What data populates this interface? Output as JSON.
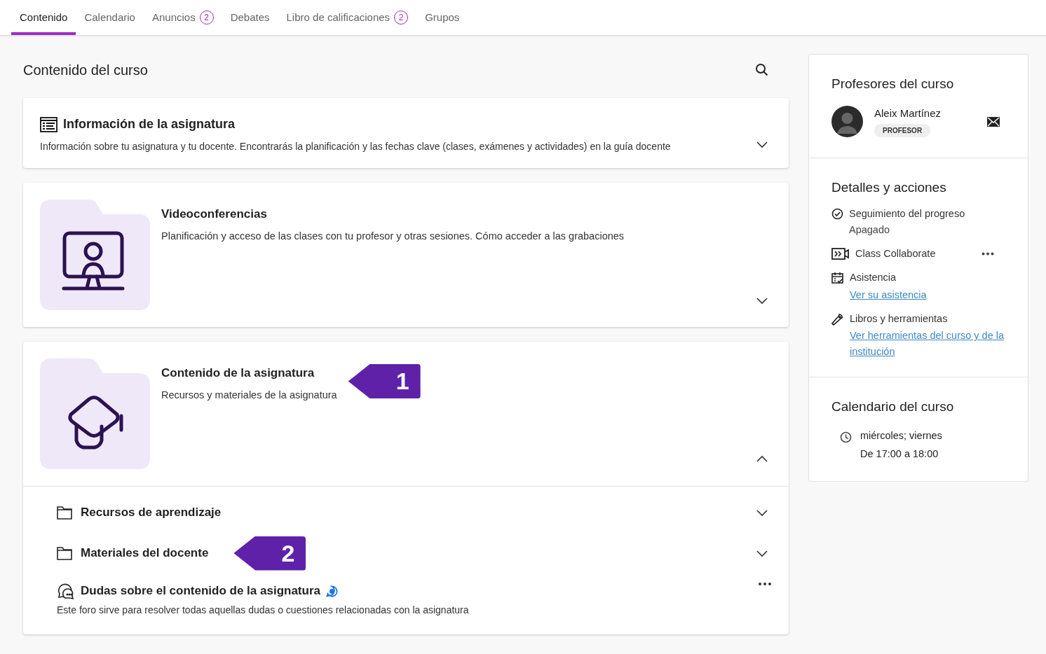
{
  "tabs": [
    {
      "label": "Contenido",
      "selected": true
    },
    {
      "label": "Calendario",
      "selected": false
    },
    {
      "label": "Anuncios",
      "badge": "2",
      "selected": false
    },
    {
      "label": "Debates",
      "selected": false
    },
    {
      "label": "Libro de calificaciones",
      "badge": "2",
      "selected": false
    },
    {
      "label": "Grupos",
      "selected": false
    }
  ],
  "main": {
    "title": "Contenido del curso",
    "items": [
      {
        "kind": "info",
        "title": "Información de la asignatura",
        "description": "Información sobre tu asignatura y tu docente. Encontrarás la planificación y las fechas clave (clases, exámenes y actividades) en la guía docente",
        "expanded": false
      },
      {
        "kind": "video",
        "title": "Videoconferencias",
        "description": "Planificación y acceso de las clases con tu profesor y otras sesiones. Cómo acceder a las grabaciones",
        "expanded": false
      },
      {
        "kind": "course",
        "title": "Contenido de la asignatura",
        "description": "Recursos y materiales de la asignatura",
        "callout": "1",
        "expanded": true,
        "children": [
          {
            "kind": "folder",
            "title": "Recursos de aprendizaje",
            "expanded": false
          },
          {
            "kind": "folder",
            "title": "Materiales del docente",
            "callout": "2",
            "expanded": false
          },
          {
            "kind": "forum",
            "title": "Dudas sobre el contenido de la asignatura",
            "description": "Este foro sirve para resolver todas aquellas dudas o cuestiones relacionadas con la asignatura"
          }
        ]
      }
    ]
  },
  "sidebar": {
    "teachers": {
      "title": "Profesores del curso",
      "people": [
        {
          "name": "Aleix Martínez",
          "role": "PROFESOR"
        }
      ]
    },
    "details": {
      "title": "Detalles y acciones",
      "items": [
        {
          "kind": "progress",
          "label": "Seguimiento del progreso",
          "value": "Apagado"
        },
        {
          "kind": "collaborate",
          "label": "Class Collaborate"
        },
        {
          "kind": "attendance",
          "label": "Asistencia",
          "link": "Ver su asistencia"
        },
        {
          "kind": "tools",
          "label": "Libros y herramientas",
          "link": "Ver herramientas del curso y de la institución"
        }
      ]
    },
    "calendar": {
      "title": "Calendario del curso",
      "days": "miércoles; viernes",
      "hours": "De 17:00 a 18:00"
    }
  }
}
